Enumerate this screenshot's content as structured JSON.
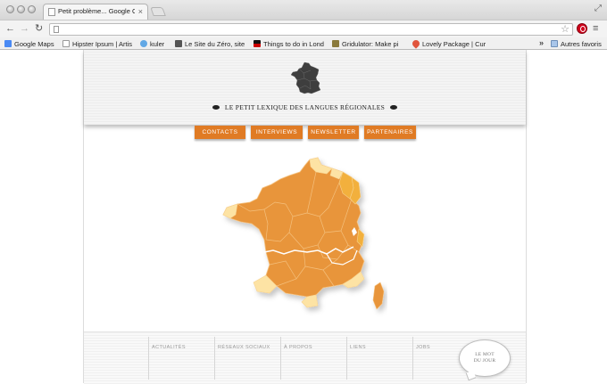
{
  "browser": {
    "tab_title": "Petit problème... Google Ch",
    "address_value": "",
    "bookmarks": [
      {
        "label": "Google Maps",
        "color": "#4a8af4"
      },
      {
        "label": "Hipster Ipsum | Artis",
        "color": "#ffffff"
      },
      {
        "label": "kuler",
        "color": "#62a8e5"
      },
      {
        "label": "Le Site du Zéro, site",
        "color": "#555555"
      },
      {
        "label": "Things to do in Lond",
        "color": "#cc0000"
      },
      {
        "label": "Gridulator: Make pi",
        "color": "#8a7a3c"
      },
      {
        "label": "Lovely Package | Cur",
        "color": "#e0553d"
      }
    ],
    "bookmarks_more": "»",
    "other_bookmarks": "Autres favoris"
  },
  "site": {
    "title": "LE PETIT LEXIQUE DES LANGUES RÉGIONALES",
    "nav": [
      "CONTACTS",
      "INTERVIEWS",
      "NEWSLETTER",
      "PARTENAIRES"
    ],
    "footer_cols": [
      "ACTUALITÉS",
      "RÉSEAUX SOCIAUX",
      "À PROPOS",
      "LIENS",
      "JOBS"
    ],
    "word_of_day": "LE MOT DU JOUR"
  },
  "colors": {
    "accent": "#e07b24",
    "map_main": "#e8953a",
    "map_light": "#fde3a4",
    "map_mid": "#f2b03c"
  }
}
